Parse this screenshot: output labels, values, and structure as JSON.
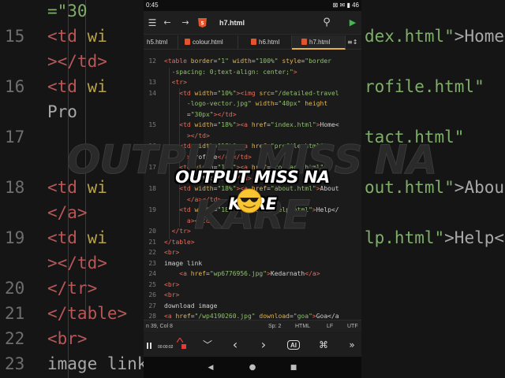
{
  "background": {
    "lines": [
      {
        "num": "",
        "code": [
          {
            "c": "str",
            "t": "=\"30"
          }
        ]
      },
      {
        "num": "15",
        "code": [
          {
            "c": "tag",
            "t": "<td "
          },
          {
            "c": "attr",
            "t": "wi"
          }
        ],
        "right": [
          {
            "c": "str",
            "t": "dex.html\""
          },
          {
            "c": "tx",
            "t": ">Home<"
          }
        ]
      },
      {
        "num": "",
        "code": [
          {
            "c": "tag",
            "t": "  ></td>"
          }
        ]
      },
      {
        "num": "16",
        "code": [
          {
            "c": "tag",
            "t": "<td "
          },
          {
            "c": "attr",
            "t": "wi"
          }
        ],
        "right": [
          {
            "c": "str",
            "t": "rofile.html\""
          }
        ]
      },
      {
        "num": "",
        "code": [
          {
            "c": "tx",
            "t": "  Pro"
          }
        ]
      },
      {
        "num": "17",
        "code": [
          {
            "c": "tag",
            "t": ""
          }
        ],
        "right": [
          {
            "c": "str",
            "t": "tact.html\""
          }
        ]
      },
      {
        "num": "",
        "code": [
          {
            "c": "tx",
            "t": ""
          }
        ]
      },
      {
        "num": "18",
        "code": [
          {
            "c": "tag",
            "t": "<td "
          },
          {
            "c": "attr",
            "t": "wi"
          }
        ],
        "right": [
          {
            "c": "str",
            "t": "out.html\""
          },
          {
            "c": "tx",
            "t": ">About"
          }
        ]
      },
      {
        "num": "",
        "code": [
          {
            "c": "tag",
            "t": "  </a>"
          }
        ]
      },
      {
        "num": "19",
        "code": [
          {
            "c": "tag",
            "t": "<td "
          },
          {
            "c": "attr",
            "t": "wi"
          }
        ],
        "right": [
          {
            "c": "str",
            "t": "lp.html\""
          },
          {
            "c": "tx",
            "t": ">Help</"
          }
        ]
      },
      {
        "num": "",
        "code": [
          {
            "c": "tag",
            "t": "  ></td>"
          }
        ]
      },
      {
        "num": "20",
        "code": [
          {
            "c": "tag",
            "t": " </tr>"
          }
        ]
      },
      {
        "num": "21",
        "code": [
          {
            "c": "tag",
            "t": "</table>"
          }
        ]
      },
      {
        "num": "22",
        "code": [
          {
            "c": "tag",
            "t": "<br>"
          }
        ]
      },
      {
        "num": "23",
        "code": [
          {
            "c": "tx",
            "t": "image link"
          }
        ]
      }
    ]
  },
  "status": {
    "time": "0:45",
    "icons": "⊠ ✉ ▮ 46"
  },
  "appbar": {
    "menu": "☰",
    "undo": "←",
    "redo": "→",
    "filename": "h7.html",
    "search": "⚲",
    "run": "▶"
  },
  "tabs": [
    {
      "label": "h5.html",
      "active": false,
      "badge": false
    },
    {
      "label": "colour.html",
      "active": false,
      "badge": true
    },
    {
      "label": "h6.html",
      "active": false,
      "badge": true
    },
    {
      "label": "h7.html",
      "active": true,
      "badge": true
    }
  ],
  "tab_more": "≡↕",
  "editor": {
    "lines": [
      {
        "num": "12",
        "parts": [
          {
            "c": "t",
            "t": "<table "
          },
          {
            "c": "a",
            "t": "border"
          },
          {
            "c": "p",
            "t": "="
          },
          {
            "c": "s",
            "t": "\"1\""
          },
          {
            "c": "a",
            "t": " width"
          },
          {
            "c": "p",
            "t": "="
          },
          {
            "c": "s",
            "t": "\"100%\""
          },
          {
            "c": "a",
            "t": " style"
          },
          {
            "c": "p",
            "t": "="
          },
          {
            "c": "s",
            "t": "\"border"
          }
        ]
      },
      {
        "num": "",
        "parts": [
          {
            "c": "s",
            "t": "  -spacing: 0;text-align: center;\""
          },
          {
            "c": "t",
            "t": ">"
          }
        ]
      },
      {
        "num": "13",
        "parts": [
          {
            "c": "t",
            "t": "  <tr>"
          }
        ]
      },
      {
        "num": "14",
        "parts": [
          {
            "c": "t",
            "t": "    <td "
          },
          {
            "c": "a",
            "t": "width"
          },
          {
            "c": "p",
            "t": "="
          },
          {
            "c": "s",
            "t": "\"10%\""
          },
          {
            "c": "t",
            "t": "><img "
          },
          {
            "c": "a",
            "t": "src"
          },
          {
            "c": "p",
            "t": "="
          },
          {
            "c": "s",
            "t": "\"/detailed-travel"
          }
        ]
      },
      {
        "num": "",
        "parts": [
          {
            "c": "s",
            "t": "      -logo-vector.jpg\""
          },
          {
            "c": "a",
            "t": " width"
          },
          {
            "c": "p",
            "t": "="
          },
          {
            "c": "s",
            "t": "\"40px\""
          },
          {
            "c": "a",
            "t": " height"
          }
        ]
      },
      {
        "num": "",
        "parts": [
          {
            "c": "p",
            "t": "      ="
          },
          {
            "c": "s",
            "t": "\"30px\""
          },
          {
            "c": "t",
            "t": "></td>"
          }
        ]
      },
      {
        "num": "15",
        "parts": [
          {
            "c": "t",
            "t": "    <td "
          },
          {
            "c": "a",
            "t": "width"
          },
          {
            "c": "p",
            "t": "="
          },
          {
            "c": "s",
            "t": "\"18%\""
          },
          {
            "c": "t",
            "t": "><a "
          },
          {
            "c": "a",
            "t": "href"
          },
          {
            "c": "p",
            "t": "="
          },
          {
            "c": "s",
            "t": "\"index.html\""
          },
          {
            "c": "t",
            "t": ">"
          },
          {
            "c": "p",
            "t": "Home<"
          }
        ]
      },
      {
        "num": "",
        "parts": [
          {
            "c": "t",
            "t": "      ></td>"
          }
        ]
      },
      {
        "num": "16",
        "parts": [
          {
            "c": "t",
            "t": "    <td "
          },
          {
            "c": "a",
            "t": "width"
          },
          {
            "c": "p",
            "t": "="
          },
          {
            "c": "s",
            "t": "\"18%\""
          },
          {
            "c": "t",
            "t": "><a "
          },
          {
            "c": "a",
            "t": "href"
          },
          {
            "c": "p",
            "t": "="
          },
          {
            "c": "s",
            "t": "\"profile.html\""
          }
        ]
      },
      {
        "num": "",
        "parts": [
          {
            "c": "t",
            "t": "      >"
          },
          {
            "c": "p",
            "t": "Profile"
          },
          {
            "c": "t",
            "t": "</a></td>"
          }
        ]
      },
      {
        "num": "17",
        "parts": [
          {
            "c": "t",
            "t": "    <td "
          },
          {
            "c": "a",
            "t": "width"
          },
          {
            "c": "p",
            "t": "="
          },
          {
            "c": "s",
            "t": "\"18%\""
          },
          {
            "c": "t",
            "t": "><a "
          },
          {
            "c": "a",
            "t": "href"
          },
          {
            "c": "p",
            "t": "="
          },
          {
            "c": "s",
            "t": "\"contact.html\""
          }
        ]
      },
      {
        "num": "",
        "parts": [
          {
            "c": "t",
            "t": "      >"
          },
          {
            "c": "p",
            "t": "Contact"
          },
          {
            "c": "t",
            "t": "</a></td>"
          }
        ]
      },
      {
        "num": "18",
        "parts": [
          {
            "c": "t",
            "t": "    <td "
          },
          {
            "c": "a",
            "t": "width"
          },
          {
            "c": "p",
            "t": "="
          },
          {
            "c": "s",
            "t": "\"18%\""
          },
          {
            "c": "t",
            "t": "><a "
          },
          {
            "c": "a",
            "t": "href"
          },
          {
            "c": "p",
            "t": "="
          },
          {
            "c": "s",
            "t": "\"about.html\""
          },
          {
            "c": "t",
            "t": ">"
          },
          {
            "c": "p",
            "t": "About"
          }
        ]
      },
      {
        "num": "",
        "parts": [
          {
            "c": "t",
            "t": "      </a></td>"
          }
        ]
      },
      {
        "num": "19",
        "parts": [
          {
            "c": "t",
            "t": "    <td "
          },
          {
            "c": "a",
            "t": "width"
          },
          {
            "c": "p",
            "t": "="
          },
          {
            "c": "s",
            "t": "\"18%\""
          },
          {
            "c": "t",
            "t": "><a "
          },
          {
            "c": "a",
            "t": "href"
          },
          {
            "c": "p",
            "t": "="
          },
          {
            "c": "s",
            "t": "\"help.html\""
          },
          {
            "c": "t",
            "t": ">"
          },
          {
            "c": "p",
            "t": "Help</"
          }
        ]
      },
      {
        "num": "",
        "parts": [
          {
            "c": "t",
            "t": "      a></td>"
          }
        ]
      },
      {
        "num": "20",
        "parts": [
          {
            "c": "t",
            "t": "  </tr>"
          }
        ]
      },
      {
        "num": "21",
        "parts": [
          {
            "c": "t",
            "t": "</table>"
          }
        ]
      },
      {
        "num": "22",
        "parts": [
          {
            "c": "t",
            "t": "<br>"
          }
        ]
      },
      {
        "num": "23",
        "parts": [
          {
            "c": "p",
            "t": "image link"
          }
        ]
      },
      {
        "num": "24",
        "parts": [
          {
            "c": "t",
            "t": "    <a "
          },
          {
            "c": "a",
            "t": "href"
          },
          {
            "c": "p",
            "t": "="
          },
          {
            "c": "s",
            "t": "\"wp6776956.jpg\""
          },
          {
            "c": "t",
            "t": ">"
          },
          {
            "c": "p",
            "t": "Kedarnath"
          },
          {
            "c": "t",
            "t": "</a>"
          }
        ]
      },
      {
        "num": "25",
        "parts": [
          {
            "c": "t",
            "t": "<br>"
          }
        ]
      },
      {
        "num": "26",
        "parts": [
          {
            "c": "t",
            "t": "<br>"
          }
        ]
      },
      {
        "num": "27",
        "parts": [
          {
            "c": "p",
            "t": "download image"
          }
        ]
      },
      {
        "num": "28",
        "parts": [
          {
            "c": "t",
            "t": "<a "
          },
          {
            "c": "a",
            "t": "href"
          },
          {
            "c": "p",
            "t": "="
          },
          {
            "c": "s",
            "t": "\"/wp4190260.jpg\""
          },
          {
            "c": "a",
            "t": " download"
          },
          {
            "c": "p",
            "t": "="
          },
          {
            "c": "s",
            "t": "\"goa\""
          },
          {
            "c": "t",
            "t": ">"
          },
          {
            "c": "p",
            "t": "Goa</a"
          }
        ]
      }
    ]
  },
  "infobar": {
    "position": "n 39, Col 8",
    "spaces": "Sp: 2",
    "language": "HTML",
    "line_ending": "LF",
    "encoding": "UTF"
  },
  "recorder": {
    "time": "00:00:02"
  },
  "keybar": {
    "down": "﹀",
    "left": "‹",
    "right": "›",
    "ai": "AI",
    "cmd": "⌘",
    "more": "»"
  },
  "navbar": {
    "back": "◀",
    "home": "●",
    "recents": "■"
  },
  "overlay": {
    "background_text": "OUTPUT MISS NA KARE",
    "caption": "OUTPUT MISS NA KARE"
  },
  "colors": {
    "accent": "#e6b24a",
    "tag": "#e46d5d",
    "attr": "#e2b44f",
    "string": "#8ec06c",
    "html_badge": "#e0542e",
    "run": "#3fb950"
  }
}
